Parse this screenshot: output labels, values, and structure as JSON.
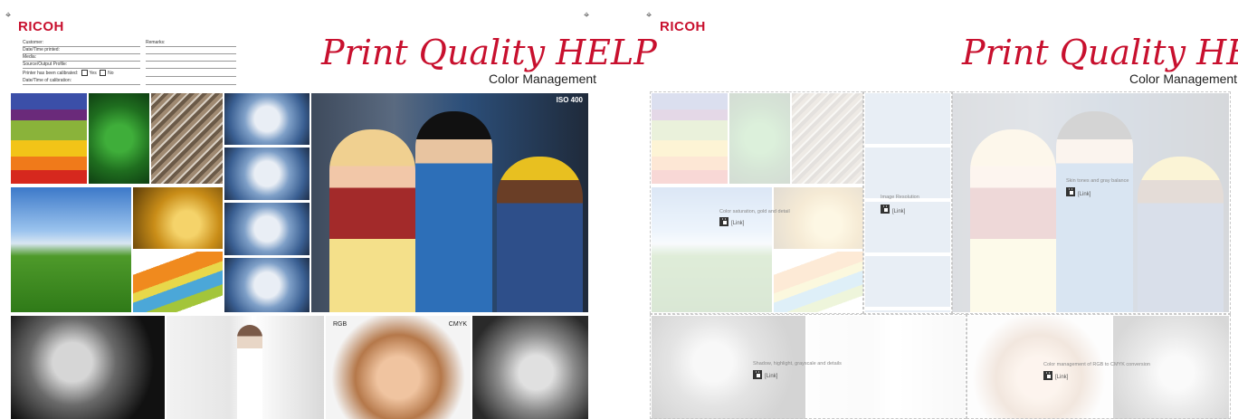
{
  "brand": "RICOH",
  "title": "Print Quality HELP",
  "subtitle": "Color Management",
  "form": {
    "customer": "Customer:",
    "datetime_printed": "Date/Time printed:",
    "media": "Media:",
    "source_output_profile": "Source/Output Profile:",
    "calibrated": "Printer has been calibrated:",
    "yes": "Yes",
    "no": "No",
    "calibration_datetime": "Date/Time of calibration:",
    "remarks": "Remarks:"
  },
  "labels": {
    "iso": "ISO 400",
    "rgb": "RGB",
    "cmyk": "CMYK"
  },
  "notes": {
    "color_saturation": "Color saturation, gold and detail",
    "image_resolution": "Image Resolution",
    "skin_tones": "Skin tones and gray balance",
    "shadow_highlight": "Shadow, highlight, grayscale and details",
    "rgb_to_cmyk": "Color management of RGB to CMYK conversion",
    "link": "[Link]"
  },
  "colors": {
    "brand_red": "#c8102e"
  }
}
